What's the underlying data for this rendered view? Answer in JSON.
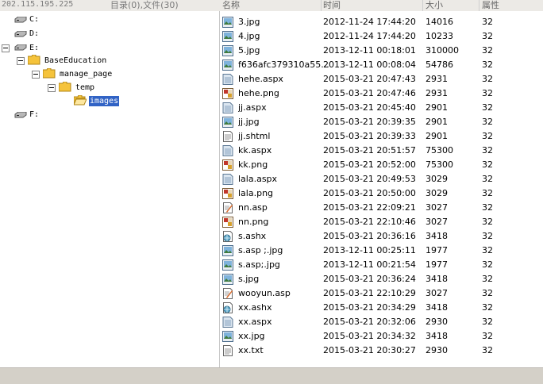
{
  "header": {
    "ip": "202.115.195.225",
    "dir_file_count": "目录(0),文件(30)",
    "columns": [
      "名称",
      "时间",
      "大小",
      "属性"
    ]
  },
  "tree": {
    "drives": [
      "C:",
      "D:",
      "E:",
      "F:"
    ],
    "folders": [
      "BaseEducation",
      "manage_page",
      "temp",
      "images"
    ]
  },
  "files": [
    {
      "name": "3.jpg",
      "time": "2012-11-24 17:44:20",
      "size": "14016",
      "attr": "32",
      "icon": "image-file-icon"
    },
    {
      "name": "4.jpg",
      "time": "2012-11-24 17:44:20",
      "size": "10233",
      "attr": "32",
      "icon": "image-file-icon"
    },
    {
      "name": "5.jpg",
      "time": "2013-12-11 00:18:01",
      "size": "310000",
      "attr": "32",
      "icon": "image-file-icon"
    },
    {
      "name": "f636afc379310a55...",
      "time": "2013-12-11 00:08:04",
      "size": "54786",
      "attr": "32",
      "icon": "image-file-icon"
    },
    {
      "name": "hehe.aspx",
      "time": "2015-03-21 20:47:43",
      "size": "2931",
      "attr": "32",
      "icon": "aspx-file-icon"
    },
    {
      "name": "hehe.png",
      "time": "2015-03-21 20:47:46",
      "size": "2931",
      "attr": "32",
      "icon": "png-file-icon"
    },
    {
      "name": "jj.aspx",
      "time": "2015-03-21 20:45:40",
      "size": "2901",
      "attr": "32",
      "icon": "aspx-file-icon"
    },
    {
      "name": "jj.jpg",
      "time": "2015-03-21 20:39:35",
      "size": "2901",
      "attr": "32",
      "icon": "image-file-icon"
    },
    {
      "name": "jj.shtml",
      "time": "2015-03-21 20:39:33",
      "size": "2901",
      "attr": "32",
      "icon": "text-file-icon"
    },
    {
      "name": "kk.aspx",
      "time": "2015-03-21 20:51:57",
      "size": "75300",
      "attr": "32",
      "icon": "aspx-file-icon"
    },
    {
      "name": "kk.png",
      "time": "2015-03-21 20:52:00",
      "size": "75300",
      "attr": "32",
      "icon": "png-file-icon"
    },
    {
      "name": "lala.aspx",
      "time": "2015-03-21 20:49:53",
      "size": "3029",
      "attr": "32",
      "icon": "aspx-file-icon"
    },
    {
      "name": "lala.png",
      "time": "2015-03-21 20:50:00",
      "size": "3029",
      "attr": "32",
      "icon": "png-file-icon"
    },
    {
      "name": "nn.asp",
      "time": "2015-03-21 22:09:21",
      "size": "3027",
      "attr": "32",
      "icon": "asp-file-icon"
    },
    {
      "name": "nn.png",
      "time": "2015-03-21 22:10:46",
      "size": "3027",
      "attr": "32",
      "icon": "png-file-icon"
    },
    {
      "name": "s.ashx",
      "time": "2015-03-21 20:36:16",
      "size": "3418",
      "attr": "32",
      "icon": "web-file-icon"
    },
    {
      "name": "s.asp ;.jpg",
      "time": "2013-12-11 00:25:11",
      "size": "1977",
      "attr": "32",
      "icon": "image-file-icon"
    },
    {
      "name": "s.asp;.jpg",
      "time": "2013-12-11 00:21:54",
      "size": "1977",
      "attr": "32",
      "icon": "image-file-icon"
    },
    {
      "name": "s.jpg",
      "time": "2015-03-21 20:36:24",
      "size": "3418",
      "attr": "32",
      "icon": "image-file-icon"
    },
    {
      "name": "wooyun.asp",
      "time": "2015-03-21 22:10:29",
      "size": "3027",
      "attr": "32",
      "icon": "asp-file-icon"
    },
    {
      "name": "xx.ashx",
      "time": "2015-03-21 20:34:29",
      "size": "3418",
      "attr": "32",
      "icon": "web-file-icon"
    },
    {
      "name": "xx.aspx",
      "time": "2015-03-21 20:32:06",
      "size": "2930",
      "attr": "32",
      "icon": "aspx-file-icon"
    },
    {
      "name": "xx.jpg",
      "time": "2015-03-21 20:34:32",
      "size": "3418",
      "attr": "32",
      "icon": "image-file-icon"
    },
    {
      "name": "xx.txt",
      "time": "2015-03-21 20:30:27",
      "size": "2930",
      "attr": "32",
      "icon": "text-file-icon"
    }
  ],
  "colors": {
    "selection": "#3163c5",
    "folder": "#f5c33b",
    "status_bar": "#d4d0c8"
  }
}
